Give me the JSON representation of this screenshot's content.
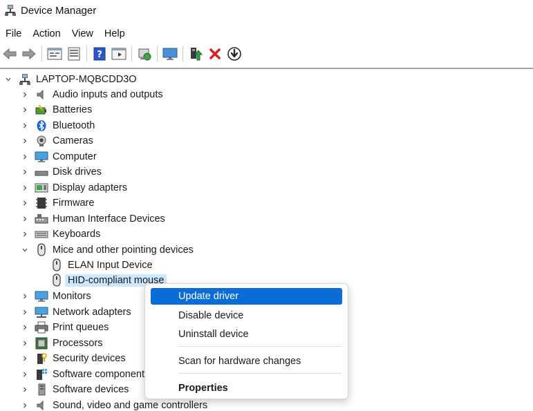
{
  "window": {
    "title": "Device Manager"
  },
  "menubar": {
    "items": [
      "File",
      "Action",
      "View",
      "Help"
    ]
  },
  "toolbar": {
    "buttons": [
      "back-arrow-icon",
      "forward-arrow-icon",
      "properties-icon",
      "device-list-icon",
      "help-icon",
      "action-pane-icon",
      "scan-hardware-icon",
      "monitor-icon",
      "update-driver-icon",
      "uninstall-icon",
      "download-icon"
    ]
  },
  "tree": {
    "root": "LAPTOP-MQBCDD3O",
    "categories": [
      {
        "label": "Audio inputs and outputs",
        "icon": "speaker-icon"
      },
      {
        "label": "Batteries",
        "icon": "battery-icon"
      },
      {
        "label": "Bluetooth",
        "icon": "bluetooth-icon"
      },
      {
        "label": "Cameras",
        "icon": "camera-icon"
      },
      {
        "label": "Computer",
        "icon": "computer-icon"
      },
      {
        "label": "Disk drives",
        "icon": "disk-drive-icon"
      },
      {
        "label": "Display adapters",
        "icon": "display-adapter-icon"
      },
      {
        "label": "Firmware",
        "icon": "firmware-icon"
      },
      {
        "label": "Human Interface Devices",
        "icon": "hid-icon"
      },
      {
        "label": "Keyboards",
        "icon": "keyboard-icon"
      },
      {
        "label": "Mice and other pointing devices",
        "icon": "mouse-icon",
        "expanded": true,
        "children": [
          {
            "label": "ELAN Input Device",
            "icon": "mouse-icon"
          },
          {
            "label": "HID-compliant mouse",
            "icon": "mouse-icon",
            "selected": true
          }
        ]
      },
      {
        "label": "Monitors",
        "icon": "monitor-icon"
      },
      {
        "label": "Network adapters",
        "icon": "network-icon"
      },
      {
        "label": "Print queues",
        "icon": "printer-icon"
      },
      {
        "label": "Processors",
        "icon": "processor-icon"
      },
      {
        "label": "Security devices",
        "icon": "security-icon"
      },
      {
        "label": "Software components",
        "icon": "software-component-icon"
      },
      {
        "label": "Software devices",
        "icon": "software-device-icon"
      },
      {
        "label": "Sound, video and game controllers",
        "icon": "speaker-icon"
      }
    ]
  },
  "context_menu": {
    "items": [
      {
        "label": "Update driver",
        "highlighted": true
      },
      {
        "label": "Disable device"
      },
      {
        "label": "Uninstall device"
      },
      {
        "label": "Scan for hardware changes"
      },
      {
        "label": "Properties",
        "bold": true
      }
    ]
  },
  "colors": {
    "selection": "#cce8ff",
    "menu_highlight": "#0a6cd6",
    "delete_red": "#d81e1e"
  }
}
